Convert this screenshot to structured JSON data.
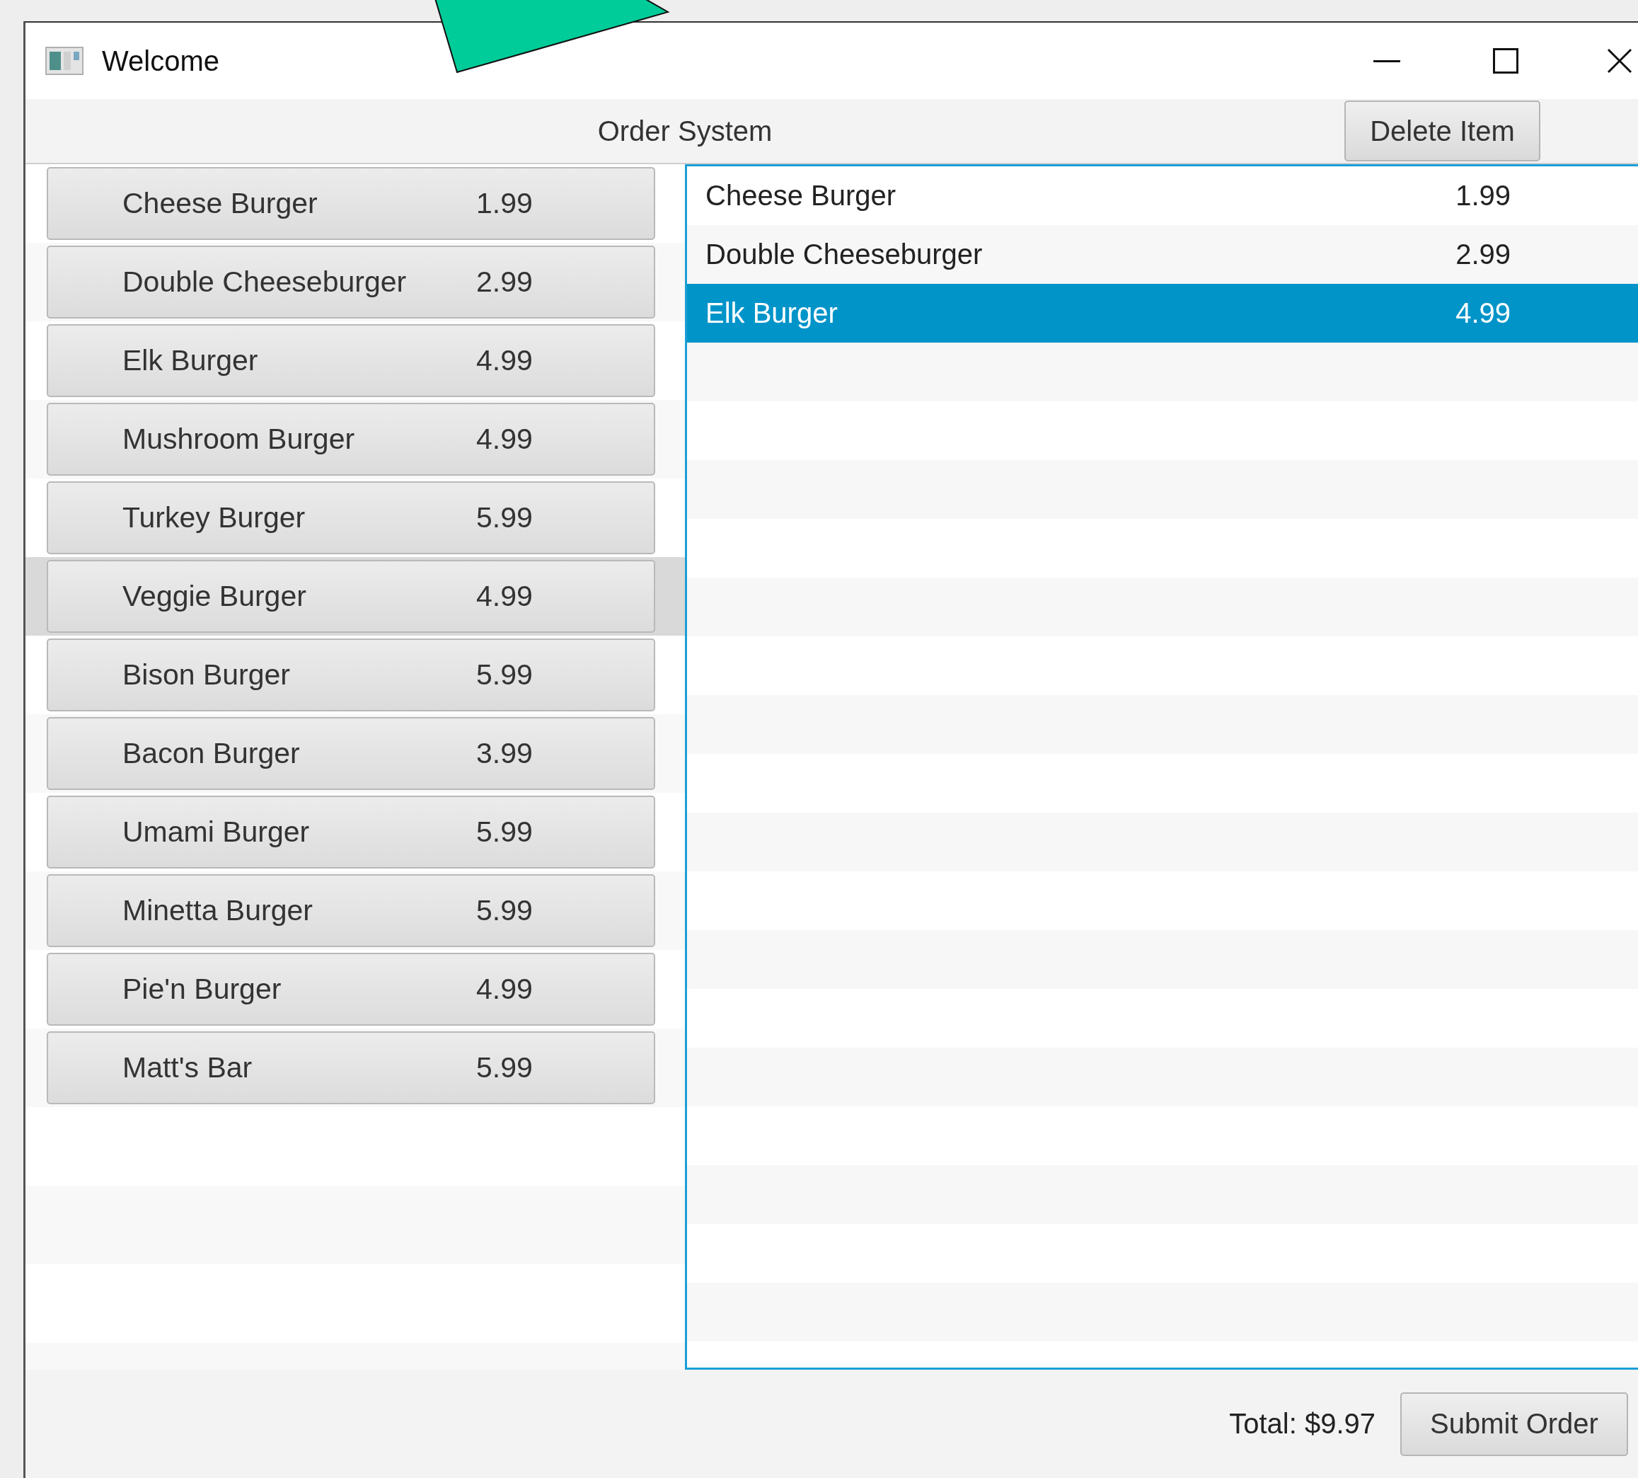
{
  "window": {
    "title": "Welcome"
  },
  "header": {
    "title": "Order System",
    "delete_button": "Delete Item"
  },
  "menu_items": [
    {
      "name": "Cheese Burger",
      "price": "1.99",
      "selected": false
    },
    {
      "name": "Double Cheeseburger",
      "price": "2.99",
      "selected": false
    },
    {
      "name": "Elk Burger",
      "price": "4.99",
      "selected": false
    },
    {
      "name": "Mushroom Burger",
      "price": "4.99",
      "selected": false
    },
    {
      "name": "Turkey Burger",
      "price": "5.99",
      "selected": false
    },
    {
      "name": "Veggie Burger",
      "price": "4.99",
      "selected": true
    },
    {
      "name": "Bison Burger",
      "price": "5.99",
      "selected": false
    },
    {
      "name": "Bacon Burger",
      "price": "3.99",
      "selected": false
    },
    {
      "name": "Umami Burger",
      "price": "5.99",
      "selected": false
    },
    {
      "name": "Minetta Burger",
      "price": "5.99",
      "selected": false
    },
    {
      "name": "Pie'n Burger",
      "price": "4.99",
      "selected": false
    },
    {
      "name": "Matt's Bar",
      "price": "5.99",
      "selected": false
    }
  ],
  "order_rows": [
    {
      "name": "Cheese Burger",
      "price": "1.99",
      "selected": false
    },
    {
      "name": "Double Cheeseburger",
      "price": "2.99",
      "selected": false
    },
    {
      "name": "Elk Burger",
      "price": "4.99",
      "selected": true
    }
  ],
  "footer": {
    "total": "Total: $9.97",
    "submit_button": "Submit Order"
  }
}
